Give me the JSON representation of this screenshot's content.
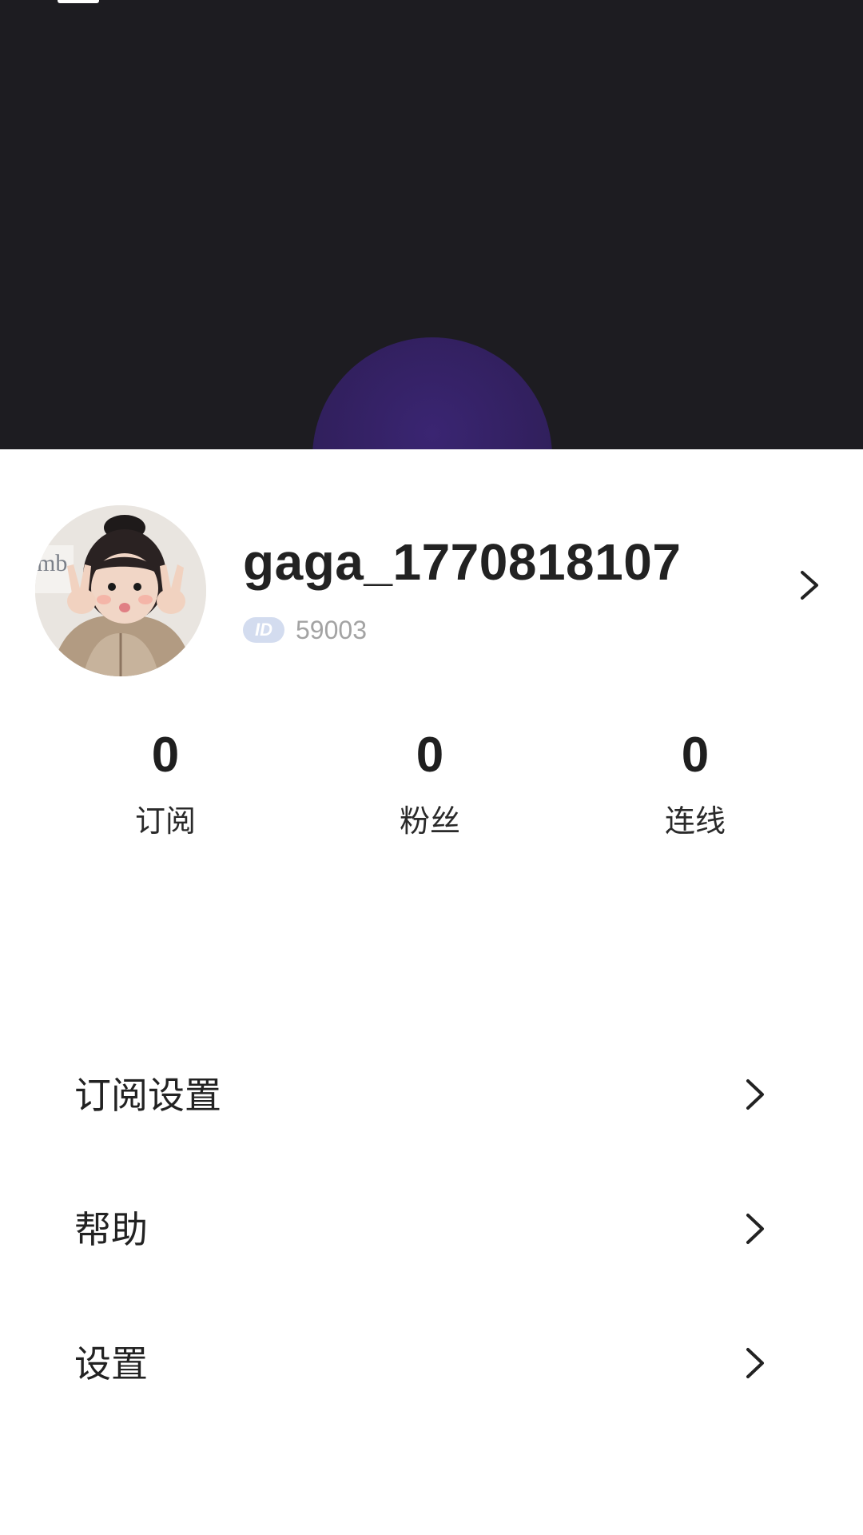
{
  "profile": {
    "username": "gaga_1770818107",
    "id_badge": "ID",
    "id_value": "59003",
    "avatar_icon": "avatar-photo",
    "chevron_icon": "chevron-right-icon"
  },
  "stats": [
    {
      "value": "0",
      "label": "订阅"
    },
    {
      "value": "0",
      "label": "粉丝"
    },
    {
      "value": "0",
      "label": "连线"
    }
  ],
  "menu": [
    {
      "label": "订阅设置",
      "icon": "chevron-right-icon"
    },
    {
      "label": "帮助",
      "icon": "chevron-right-icon"
    },
    {
      "label": "设置",
      "icon": "chevron-right-icon"
    }
  ],
  "colors": {
    "header_bg": "#1d1c21",
    "glow": "#32205f",
    "badge_bg": "#d3dcef",
    "id_text": "#a3a3a3"
  }
}
